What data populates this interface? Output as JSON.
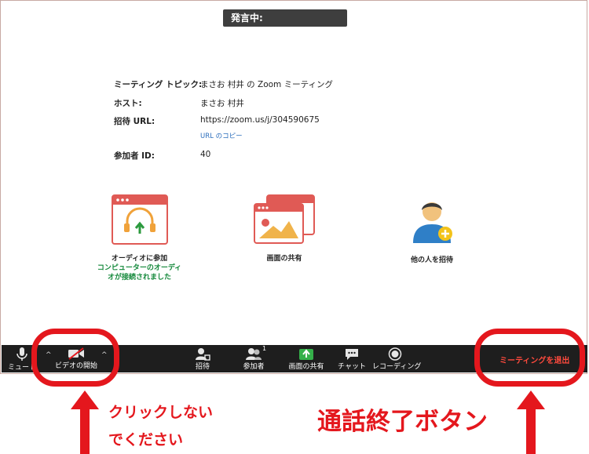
{
  "speaking_label": "発言中:",
  "meeting": {
    "topic_label": "ミーティング トピック:",
    "topic_value": "まさお 村井 の Zoom ミーティング",
    "host_label": "ホスト:",
    "host_value": "まさお 村井",
    "invite_label": "招待 URL:",
    "invite_value": "https://zoom.us/j/304590675",
    "copy_url": "URL のコピー",
    "participant_label": "参加者 ID:",
    "participant_value": "40"
  },
  "actions": {
    "audio_label": "オーディオに参加",
    "audio_status": "コンピューターのオーディオが接続されました",
    "share_label": "画面の共有",
    "invite_label": "他の人を招待"
  },
  "toolbar": {
    "mute": "ミュート",
    "video": "ビデオの開始",
    "invite": "招待",
    "participants": "参加者",
    "participants_count": "1",
    "share": "画面の共有",
    "chat": "チャット",
    "record": "レコーディング",
    "leave": "ミーティングを退出"
  },
  "annotations": {
    "no_click_line1": "クリックしない",
    "no_click_line2": "でください",
    "end_call": "通話終了ボタン"
  },
  "colors": {
    "annotation_red": "#e4171d",
    "toolbar_bg": "#1e1e1e",
    "leave_text": "#ff4a3d",
    "status_green": "#13883a",
    "link_blue": "#2d6fbd"
  }
}
